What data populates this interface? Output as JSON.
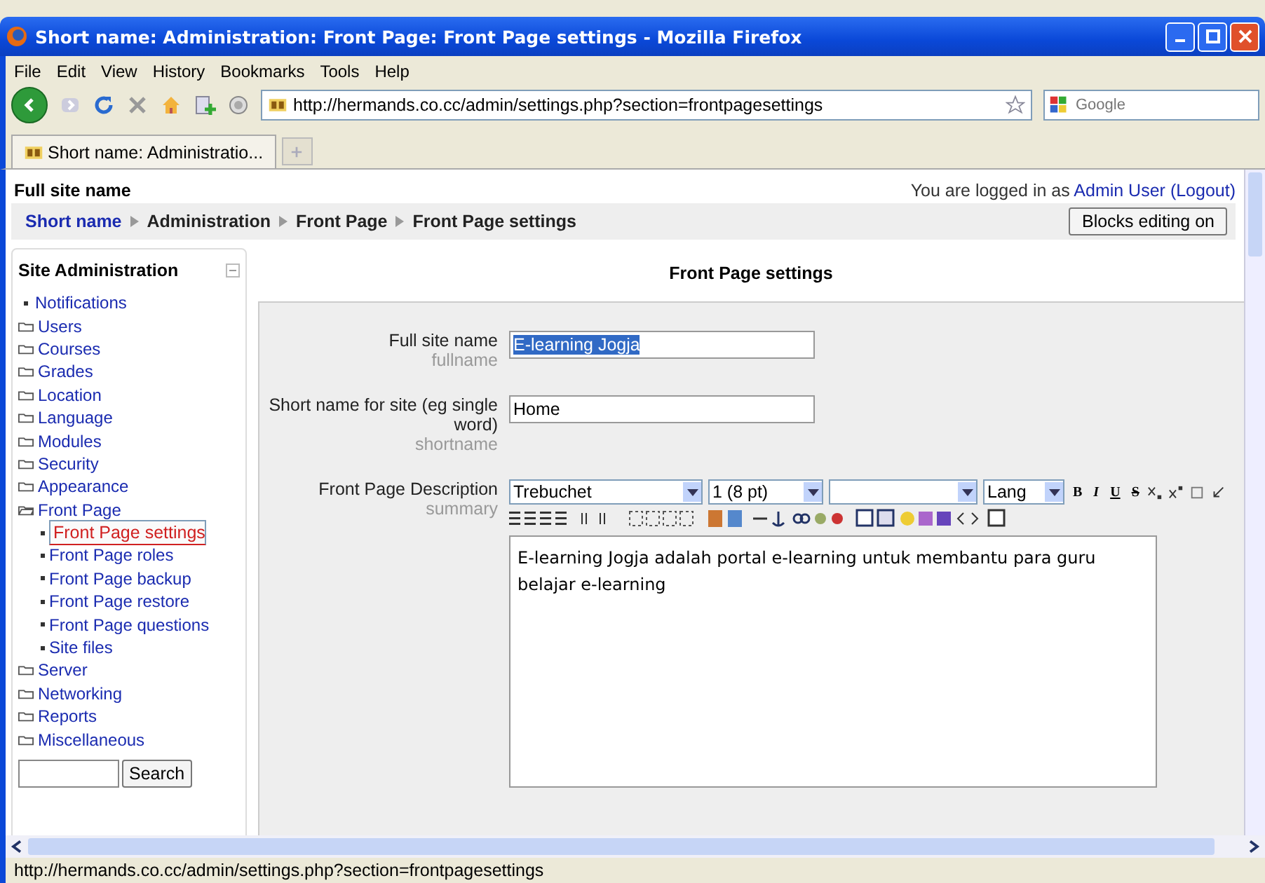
{
  "window": {
    "title": "Short name: Administration: Front Page: Front Page settings - Mozilla Firefox"
  },
  "menu": [
    "File",
    "Edit",
    "View",
    "History",
    "Bookmarks",
    "Tools",
    "Help"
  ],
  "address_bar": {
    "value": "http://hermands.co.cc/admin/settings.php?section=frontpagesettings"
  },
  "search": {
    "placeholder": "Google"
  },
  "tabs": [
    {
      "label": "Short name: Administratio...",
      "selected": true
    }
  ],
  "page": {
    "site_name": "Full site name",
    "login_prefix": "You are logged in as",
    "login_user": "Admin User",
    "logout": "(Logout)",
    "breadcrumb": [
      "Short name",
      "Administration",
      "Front Page",
      "Front Page settings"
    ],
    "blocks_button": "Blocks editing on"
  },
  "sidebar": {
    "title": "Site Administration",
    "items": [
      {
        "kind": "link",
        "label": "Notifications",
        "selected": false
      },
      {
        "kind": "folder",
        "label": "Users",
        "selected": false
      },
      {
        "kind": "folder",
        "label": "Courses",
        "selected": false
      },
      {
        "kind": "folder",
        "label": "Grades",
        "selected": false
      },
      {
        "kind": "folder",
        "label": "Location",
        "selected": false
      },
      {
        "kind": "folder",
        "label": "Language",
        "selected": false
      },
      {
        "kind": "folder",
        "label": "Modules",
        "selected": false
      },
      {
        "kind": "folder",
        "label": "Security",
        "selected": false
      },
      {
        "kind": "folder",
        "label": "Appearance",
        "selected": false
      },
      {
        "kind": "folder",
        "label": "Front Page",
        "selected": false,
        "expanded": true,
        "children": [
          {
            "kind": "link",
            "label": "Front Page settings",
            "selected": true
          },
          {
            "kind": "link",
            "label": "Front Page roles",
            "selected": false
          },
          {
            "kind": "link",
            "label": "Front Page backup",
            "selected": false
          },
          {
            "kind": "link",
            "label": "Front Page restore",
            "selected": false
          },
          {
            "kind": "link",
            "label": "Front Page questions",
            "selected": false
          },
          {
            "kind": "link",
            "label": "Site files",
            "selected": false
          }
        ]
      },
      {
        "kind": "folder",
        "label": "Server",
        "selected": false
      },
      {
        "kind": "folder",
        "label": "Networking",
        "selected": false
      },
      {
        "kind": "folder",
        "label": "Reports",
        "selected": false
      },
      {
        "kind": "folder",
        "label": "Miscellaneous",
        "selected": false
      }
    ],
    "search_button": "Search"
  },
  "form": {
    "heading": "Front Page settings",
    "fields": [
      {
        "kind": "text",
        "label": "Full site name",
        "hint": "fullname",
        "value": "E-learning Jogja",
        "text_selected": true
      },
      {
        "kind": "text",
        "label": "Short name for site (eg single word)",
        "hint": "shortname",
        "value": "Home",
        "text_selected": false
      },
      {
        "kind": "editor",
        "label": "Front Page Description",
        "hint": "summary",
        "font": "Trebuchet",
        "size": "1 (8 pt)",
        "lang": "Lang",
        "format_buttons": [
          "B",
          "I",
          "U",
          "S"
        ],
        "value": "E-learning Jogja adalah portal e-learning untuk membantu para guru belajar e-learning"
      }
    ]
  },
  "status_bar": "http://hermands.co.cc/admin/settings.php?section=frontpagesettings"
}
